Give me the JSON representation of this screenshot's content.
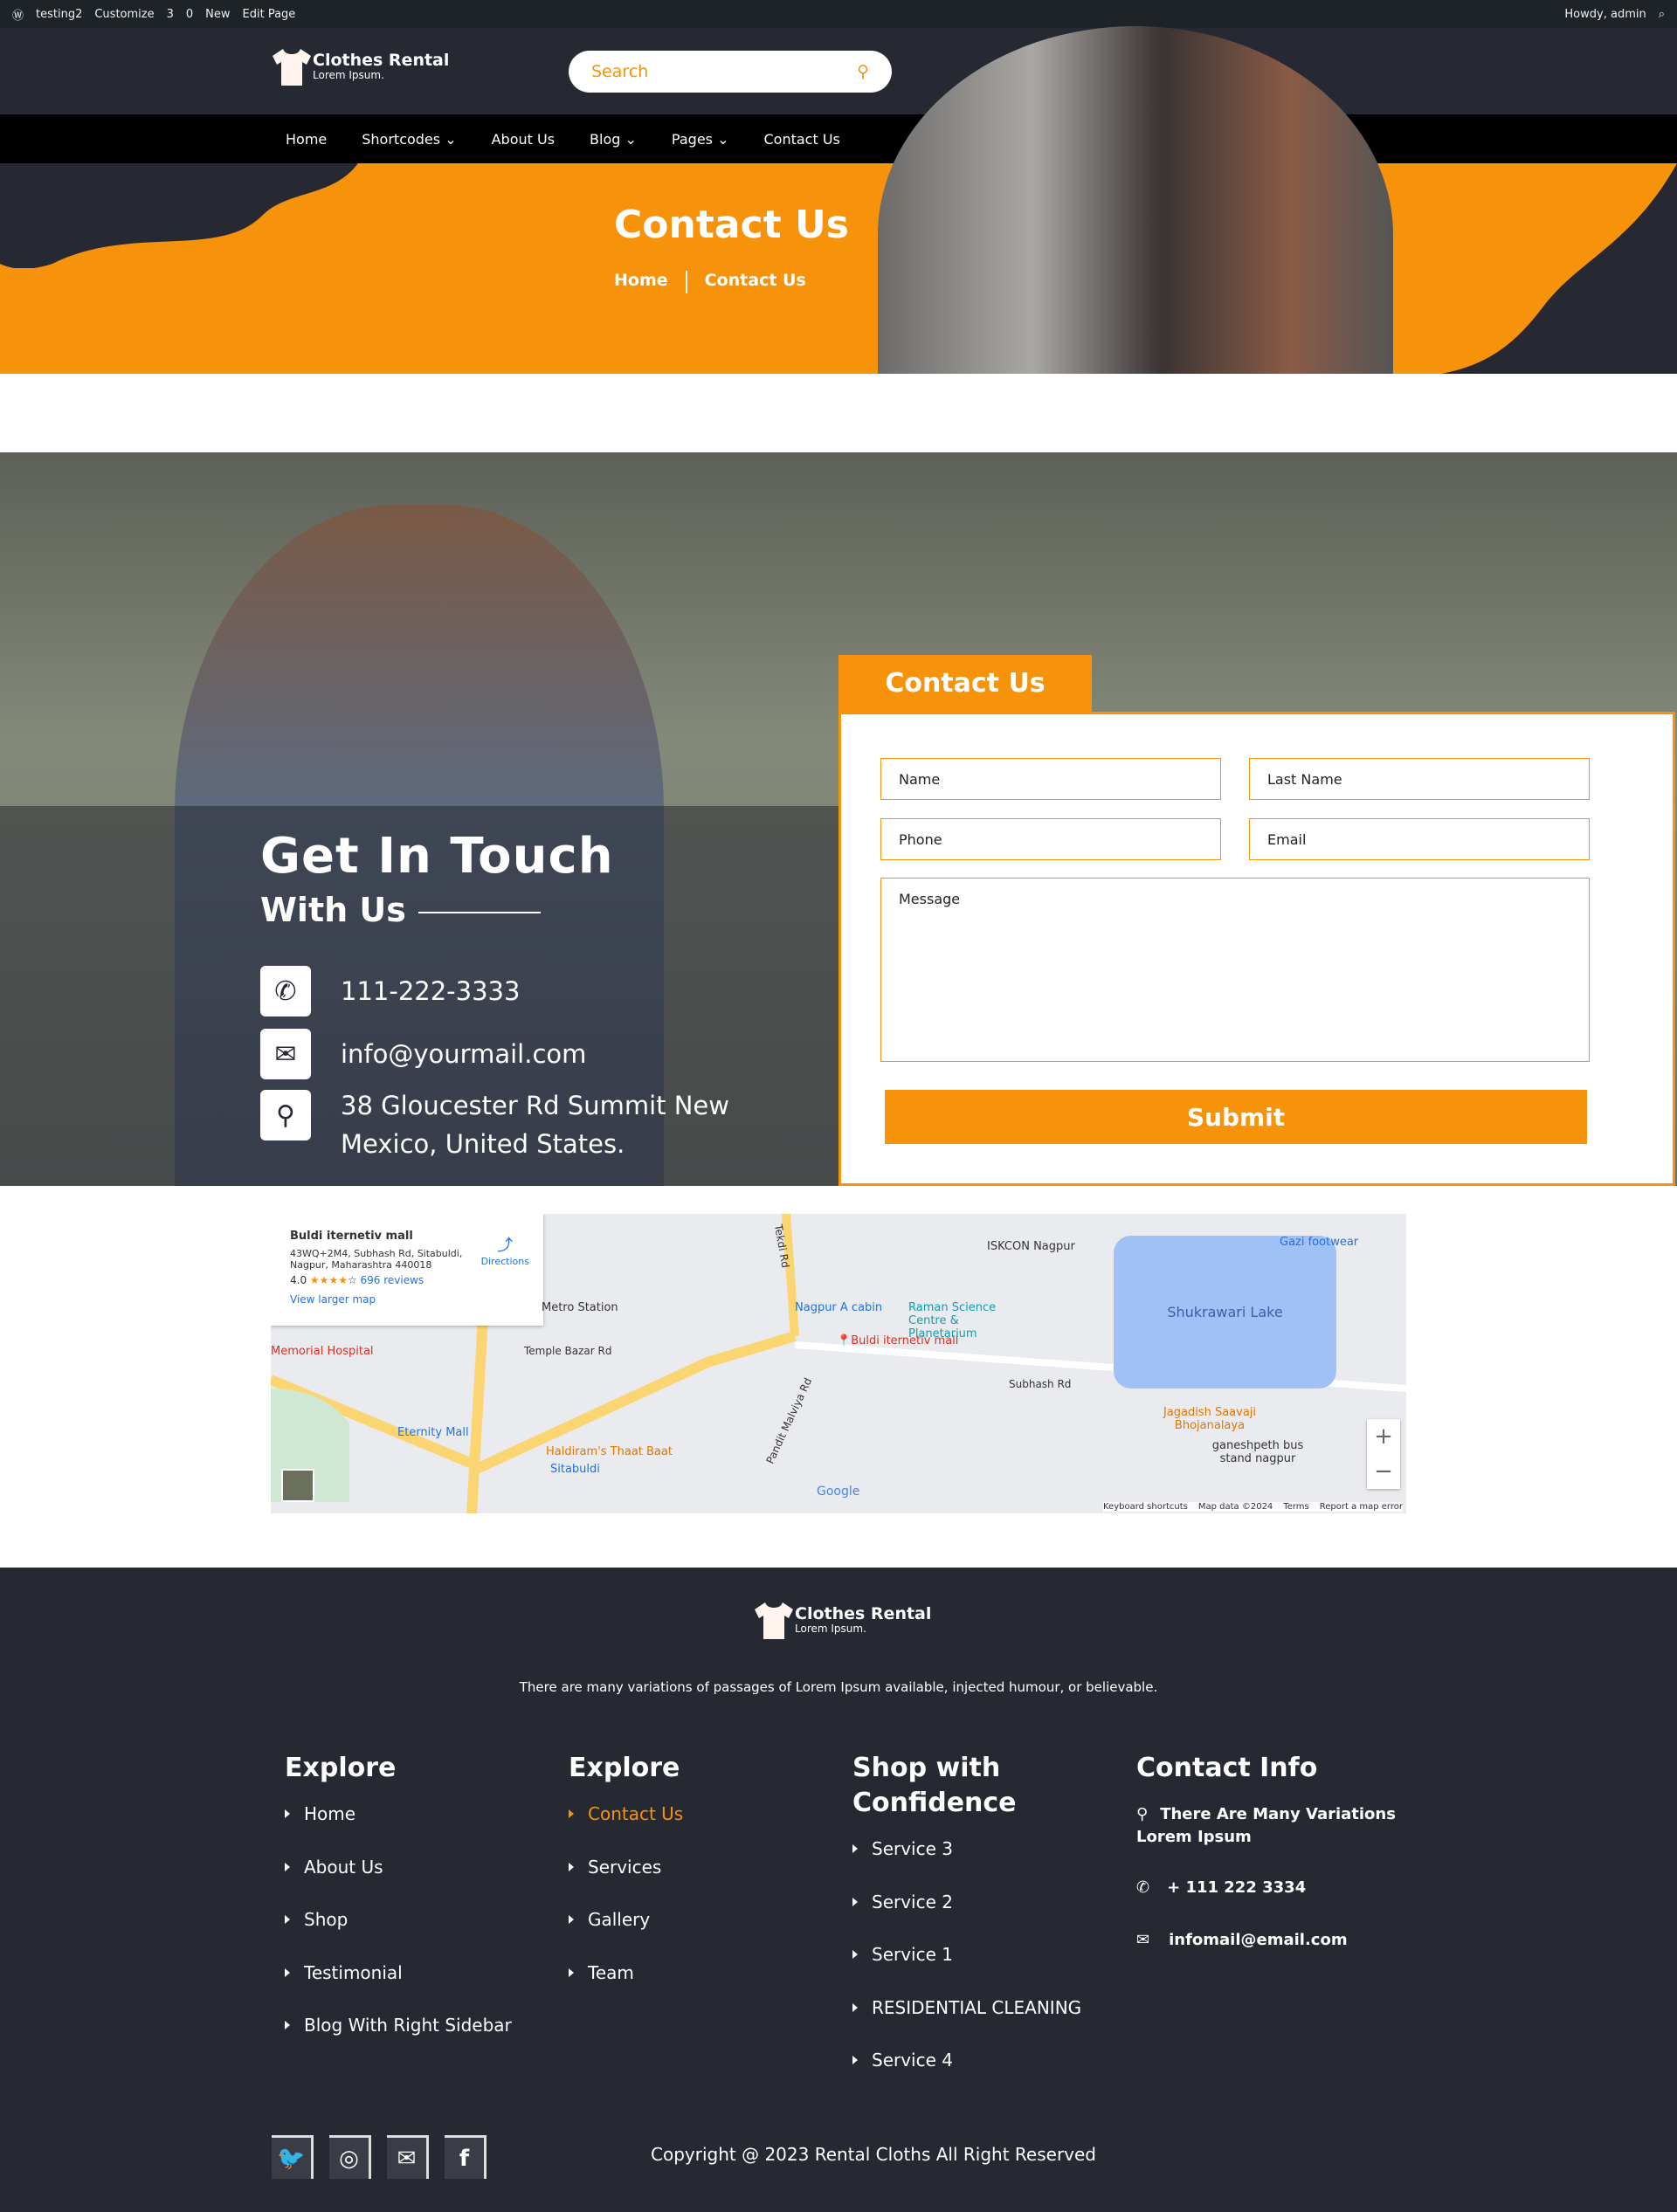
{
  "admin_bar": {
    "site": "testing2",
    "customize": "Customize",
    "updates": "3",
    "comments": "0",
    "new": "New",
    "edit_page": "Edit Page",
    "howdy": "Howdy, admin"
  },
  "brand": {
    "name": "Clothes Rental",
    "tagline": "Lorem Ipsum."
  },
  "search": {
    "placeholder": "Search"
  },
  "nav": [
    "Home",
    "Shortcodes",
    "About Us",
    "Blog",
    "Pages",
    "Contact Us"
  ],
  "hero": {
    "title": "Contact Us",
    "breadcrumb": [
      "Home",
      "Contact Us"
    ]
  },
  "contact": {
    "title": "Get In Touch",
    "subtitle": "With Us",
    "phone": "111-222-3333",
    "email": "info@yourmail.com",
    "address": "38 Gloucester Rd Summit New Mexico, United States."
  },
  "form": {
    "tab": "Contact Us",
    "name": "Name",
    "last_name": "Last Name",
    "phone": "Phone",
    "email": "Email",
    "message": "Message",
    "submit": "Submit"
  },
  "map": {
    "place": "Buldi iternetiv mall",
    "address": "43WQ+2M4, Subhash Rd, Sitabuldi, Nagpur, Maharashtra 440018",
    "rating": "4.0",
    "reviews": "696 reviews",
    "directions": "Directions",
    "larger": "View larger map",
    "lake": "Shukrawari Lake",
    "labels": [
      "Metro Station",
      "Memorial Hospital",
      "Temple Bazar Rd",
      "Eternity Mall",
      "Haldiram's Thaat Baat",
      "Sitabuldi",
      "Nagpur A cabin",
      "Raman Science Centre & Planetarium",
      "ISKCON Nagpur",
      "Subhash Rd",
      "Jagadish Saavaji Bhojanalaya",
      "ganeshpeth bus stand nagpur",
      "Gazi footwear",
      "Pandit Malviya Rd",
      "Tekdi Rd"
    ],
    "footer": [
      "Keyboard shortcuts",
      "Map data ©2024",
      "Terms",
      "Report a map error"
    ]
  },
  "footer": {
    "text": "There are many variations of passages of Lorem Ipsum available, injected humour, or believable.",
    "col1": {
      "title": "Explore",
      "items": [
        "Home",
        "About Us",
        "Shop",
        "Testimonial",
        "Blog With Right Sidebar"
      ]
    },
    "col2": {
      "title": "Explore",
      "items": [
        "Contact Us",
        "Services",
        "Gallery",
        "Team"
      ]
    },
    "col3": {
      "title": "Shop with Confidence",
      "items": [
        "Service 3",
        "Service 2",
        "Service 1",
        "RESIDENTIAL CLEANING",
        "Service 4"
      ]
    },
    "col4": {
      "title": "Contact Info",
      "address": "There Are Many Variations Lorem Ipsum",
      "phone": "+ 111 222 3334",
      "email": "infomail@email.com"
    },
    "copyright": "Copyright @ 2023 Rental Cloths All Right Reserved"
  },
  "colors": {
    "accent": "#f7930a",
    "dark": "#262932"
  }
}
